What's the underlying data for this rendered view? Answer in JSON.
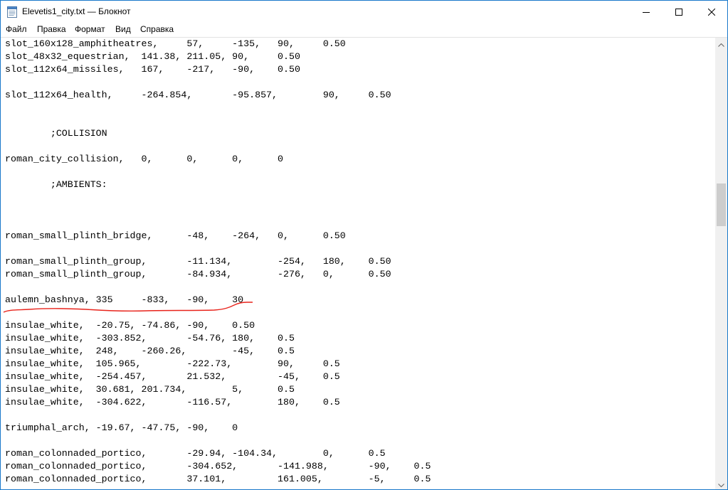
{
  "window": {
    "title": "Elevetis1_city.txt — Блокнот",
    "icon": "notepad-icon",
    "controls": [
      "minimize-icon",
      "maximize-icon",
      "close-icon"
    ]
  },
  "menu": {
    "items": [
      {
        "label": "Файл"
      },
      {
        "label": "Правка"
      },
      {
        "label": "Формат"
      },
      {
        "label": "Вид"
      },
      {
        "label": "Справка"
      }
    ]
  },
  "editor": {
    "lines": [
      "slot_160x128_amphitheatres,     57,     -135,   90,     0.50",
      "slot_48x32_equestrian,  141.38, 211.05, 90,     0.50",
      "slot_112x64_missiles,   167,    -217,   -90,    0.50",
      "",
      "slot_112x64_health,     -264.854,       -95.857,        90,     0.50",
      "",
      "",
      "        ;COLLISION",
      "",
      "roman_city_collision,   0,      0,      0,      0",
      "",
      "        ;AMBIENTS:",
      "",
      "",
      "",
      "roman_small_plinth_bridge,      -48,    -264,   0,      0.50",
      "",
      "roman_small_plinth_group,       -11.134,        -254,   180,    0.50",
      "roman_small_plinth_group,       -84.934,        -276,   0,      0.50",
      "",
      "aulemn_bashnya, 335     -833,   -90,    30",
      "",
      "insulae_white,  -20.75, -74.86, -90,    0.50",
      "insulae_white,  -303.852,       -54.76, 180,    0.5",
      "insulae_white,  248,    -260.26,        -45,    0.5",
      "insulae_white,  105.965,        -222.73,        90,     0.5",
      "insulae_white,  -254.457,       21.532,         -45,    0.5",
      "insulae_white,  30.681, 201.734,        5,      0.5",
      "insulae_white,  -304.622,       -116.57,        180,    0.5",
      "",
      "triumphal_arch, -19.67, -47.75, -90,    0",
      "",
      "roman_colonnaded_portico,       -29.94, -104.34,        0,      0.5",
      "roman_colonnaded_portico,       -304.652,       -141.988,       -90,    0.5",
      "roman_colonnaded_portico,       37.101,         161.005,        -5,     0.5"
    ],
    "annotation_color": "#e8231b",
    "annotation_note": "red hand-drawn underline under line 'aulemn_bashnya'"
  },
  "scrollbar": {
    "up_icon": "chevron-up-icon",
    "down_icon": "chevron-down-icon"
  },
  "colors": {
    "window_border": "#1979ca",
    "scrollbar_track": "#f0f0f0",
    "scrollbar_thumb": "#cdcdcd"
  }
}
